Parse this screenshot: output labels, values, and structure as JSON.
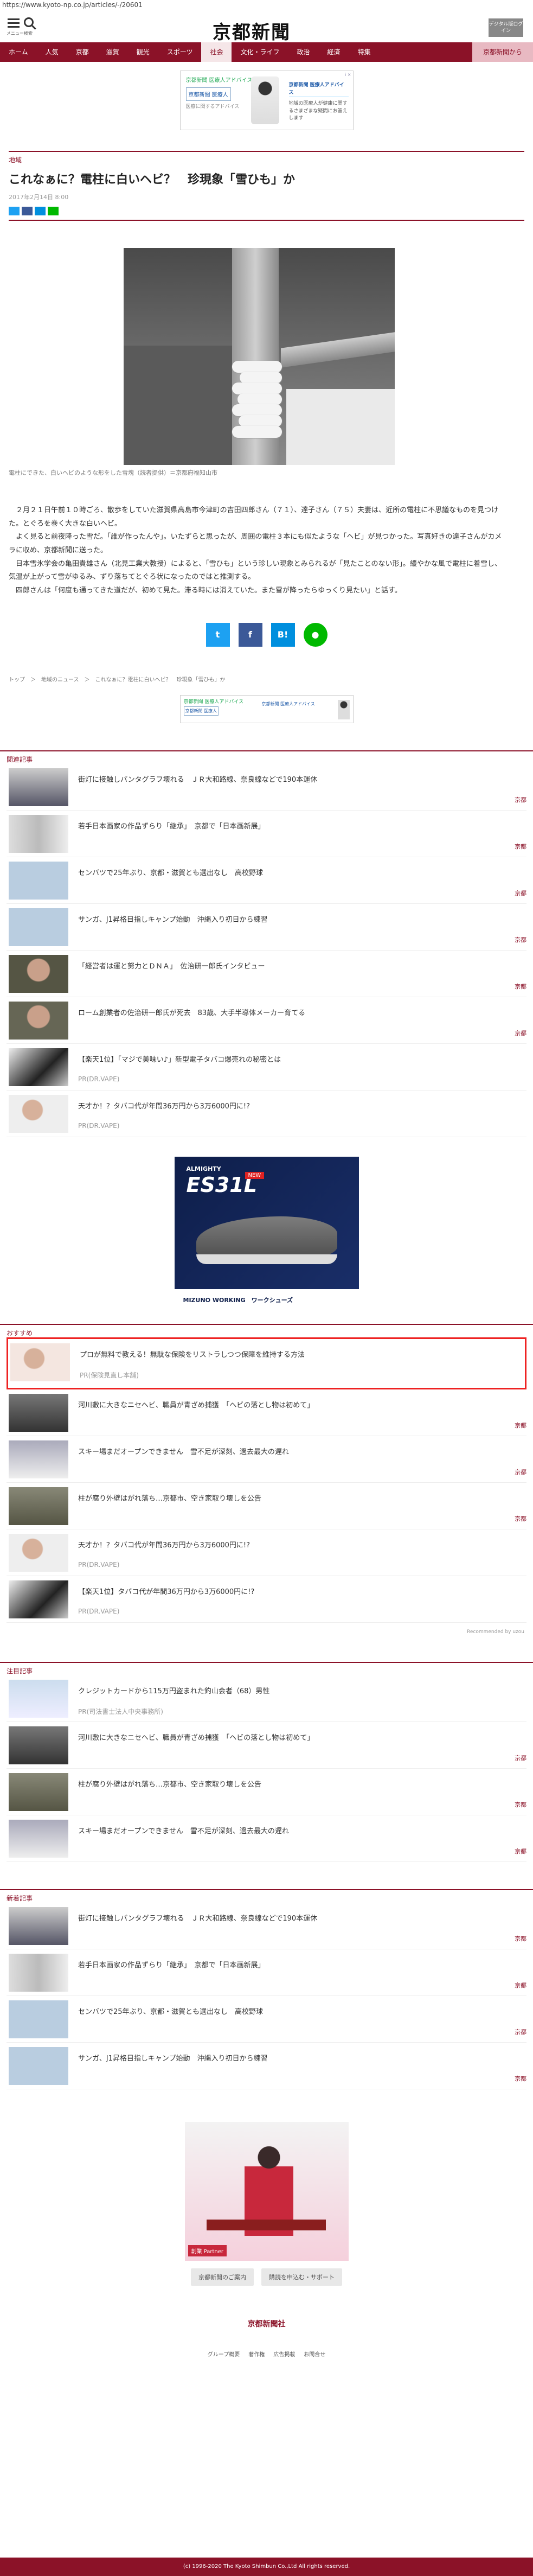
{
  "url": "https://www.kyoto-np.co.jp/articles/-/20601",
  "header": {
    "menu_label": "メニュー",
    "search_label": "検索",
    "logo": "京都新聞",
    "digital_btn": "デジタル版ログイン"
  },
  "nav": [
    "ホーム",
    "人気",
    "京都",
    "滋賀",
    "観光",
    "スポーツ",
    "社会",
    "文化・ライフ",
    "政治",
    "経済",
    "特集",
    "京都新聞から"
  ],
  "ad1": {
    "badge": "i ×",
    "title": "京都新聞 医療人アドバイス",
    "btn": "京都新聞 医療人",
    "sub": "医療に関するアドバイス",
    "right_head": "京都新聞 医療人アドバイス",
    "right_body": "地域の医療人が健康に関するさまざまな疑問にお答えします"
  },
  "article": {
    "section": "地域",
    "title": "これなぁに？電柱に白いヘビ？　珍現象「雪ひも」か",
    "date": "2017年2月14日 8:00",
    "caption": "電柱にできた、白いヘビのような形をした雪塊（読者提供）＝京都府福知山市",
    "paragraphs": [
      "２月２１日午前１０時ごろ、散歩をしていた滋賀県高島市今津町の吉田四郎さん（７１）、達子さん（７５）夫妻は、近所の電柱に不思議なものを見つけた。とぐろを巻く大きな白いヘビ。",
      "よく見ると前夜降った雪だ。「誰が作ったんや」。いたずらと思ったが、周囲の電柱３本にも似たような「ヘビ」が見つかった。写真好きの達子さんがカメラに収め、京都新聞に送った。",
      "日本雪氷学会の亀田貴雄さん（北見工業大教授）によると、「雪ひも」という珍しい現象とみられるが「見たことのない形」。緩やかな風で電柱に着雪し、気温が上がって雪がゆるみ、ずり落ちてとぐろ状になったのではと推測する。",
      "四郎さんは「何度も通ってきた道だが、初めて見た。滞る時には消えていた。また雪が降ったらゆっくり見たい」と話す。"
    ],
    "breadcrumb": "トップ　＞　地域のニュース　＞　これなぁに？電柱に白いヘビ？　珍現象「雪ひも」か",
    "share_b": "B!"
  },
  "ad2": {
    "title": "京都新聞 医療人アドバイス",
    "btn": "京都新聞 医療人",
    "right": "京都新聞 医療人アドバイス"
  },
  "related": {
    "heading": "関連記事",
    "items": [
      {
        "title": "街灯に接触しパンタグラフ壊れる　ＪＲ大和路線、奈良線などで190本運休",
        "cat": "京都"
      },
      {
        "title": "若手日本画家の作品ずらり「継承」　京都で「日本画新展」",
        "cat": "京都"
      },
      {
        "title": "センバツで25年ぶり、京都・滋賀とも選出なし　高校野球",
        "cat": "京都"
      },
      {
        "title": "サンガ、J1昇格目指しキャンプ始動　沖縄入り初日から練習",
        "cat": "京都"
      },
      {
        "title": "「経営者は運と努力とＤＮＡ」　佐治研一郎氏インタビュー",
        "cat": "京都"
      },
      {
        "title": "ローム創業者の佐治研一郎氏が死去　83歳、大手半導体メーカー育てる",
        "cat": "京都"
      },
      {
        "title": "【楽天1位】「マジで美味い♪」新型電子タバコ爆売れの秘密とは",
        "pr": "PR(DR.VAPE)"
      },
      {
        "title": "天才か！？タバコ代が年間36万円から3万6000円に!?",
        "pr": "PR(DR.VAPE)"
      }
    ]
  },
  "mizuno": {
    "line1": "ALMIGHTY",
    "line2": "ES31L",
    "new": "NEW",
    "foot": "MIZUNO WORKING　ワークシューズ"
  },
  "recommend": {
    "heading": "おすすめ",
    "items": [
      {
        "title": "プロが無料で教える！無駄な保険をリストラしつつ保障を維持する方法",
        "pr": "PR(保険見直し本舗)"
      },
      {
        "title": "河川敷に大きなニセヘビ、職員が青ざめ捕獲　「ヘビの落とし物は初めて」",
        "cat": "京都"
      },
      {
        "title": "スキー場まだオープンできません　雪不足が深刻、過去最大の遅れ",
        "cat": "京都"
      },
      {
        "title": "柱が腐り外壁はがれ落ち…京都市、空き家取り壊しを公告",
        "cat": "京都"
      },
      {
        "title": "天才か！？タバコ代が年間36万円から3万6000円に!?",
        "pr": "PR(DR.VAPE)"
      },
      {
        "title": "【楽天1位】タバコ代が年間36万円から3万6000円に!?",
        "pr": "PR(DR.VAPE)"
      }
    ],
    "credit": "Recommended by uzou"
  },
  "popular": {
    "heading": "注目記事",
    "items": [
      {
        "title": "クレジットカードから115万円盗まれた釣山会者（68）男性",
        "pr": "PR(司法書士法人中央事務所)"
      },
      {
        "title": "河川敷に大きなニセヘビ、職員が青ざめ捕獲　「ヘビの落とし物は初めて」",
        "cat": "京都"
      },
      {
        "title": "柱が腐り外壁はがれ落ち…京都市、空き家取り壊しを公告",
        "cat": "京都"
      },
      {
        "title": "スキー場まだオープンできません　雪不足が深刻、過去最大の遅れ",
        "cat": "京都"
      }
    ]
  },
  "latest": {
    "heading": "新着記事",
    "items": [
      {
        "title": "街灯に接触しパンタグラフ壊れる　ＪＲ大和路線、奈良線などで190本運休",
        "cat": "京都"
      },
      {
        "title": "若手日本画家の作品ずらり「継承」　京都で「日本画新展」",
        "cat": "京都"
      },
      {
        "title": "センバツで25年ぶり、京都・滋賀とも選出なし　高校野球",
        "cat": "京都"
      },
      {
        "title": "サンガ、J1昇格目指しキャンプ始動　沖縄入り初日から練習",
        "cat": "京都"
      }
    ]
  },
  "bigad": {
    "foot": "創業 Partner"
  },
  "buttons": [
    "京都新聞のご案内",
    "購読を申込む・サポート"
  ],
  "footer": {
    "logo": "京都新聞社",
    "links": [
      "グループ概要",
      "著作権",
      "広告掲載",
      "お問合せ"
    ],
    "copyright": "(c) 1996-2020 The Kyoto Shimbun Co.,Ltd All rights reserved."
  },
  "colors": {
    "brand": "#8b1228",
    "twitter": "#1da1f2",
    "facebook": "#3b5998",
    "hatena": "#008fde",
    "line": "#00b900"
  }
}
